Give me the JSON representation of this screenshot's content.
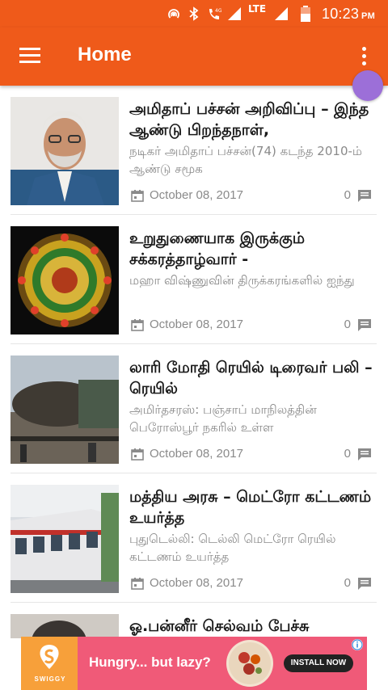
{
  "status_bar": {
    "network_label": "LTE",
    "time": "10:23",
    "ampm": "PM",
    "icons": [
      "hotspot-icon",
      "bluetooth-icon",
      "volte-call-icon",
      "signal-icon",
      "signal-icon",
      "battery-icon"
    ]
  },
  "app_bar": {
    "title": "Home",
    "icons": [
      "menu-icon",
      "overflow-menu-icon"
    ],
    "color": "#ef5a1a"
  },
  "articles": [
    {
      "title": "அமிதாப் பச்சன் அறிவிப்பு – இந்த ஆண்டு பிறந்தநாள்,",
      "excerpt": "நடிகர் அமிதாப் பச்சன்(74) கடந்த 2010-ம் ஆண்டு சமூக",
      "date": "October 08, 2017",
      "comments": "0"
    },
    {
      "title": "உறுதுணையாக இருக்கும் சக்கரத்தாழ்வார் -",
      "excerpt": "மஹா விஷ்ணுவின் திருக்கரங்களில் ஐந்து",
      "date": "October 08, 2017",
      "comments": "0"
    },
    {
      "title": "லாரி மோதி ரெயில் டிரைவர் பலி – ரெயில்",
      "excerpt": "அமிர்தசரஸ்: பஞ்சாப் மாநிலத்தின் பெரோஸ்பூர் நகரில் உள்ள",
      "date": "October 08, 2017",
      "comments": "0"
    },
    {
      "title": "மத்திய அரசு – மெட்ரோ கட்டணம் உயர்த்த",
      "excerpt": "புதுடெல்லி: டெல்லி மெட்ரோ ரெயில் கட்டணம் உயர்த்த",
      "date": "October 08, 2017",
      "comments": "0"
    },
    {
      "title": "ஓ.பன்னீர் செல்வம் பேச்சு"
    }
  ],
  "ad": {
    "brand": "SWIGGY",
    "headline": "Hungry... but lazy?",
    "cta": "INSTALL NOW",
    "accent": "#f05a78"
  }
}
